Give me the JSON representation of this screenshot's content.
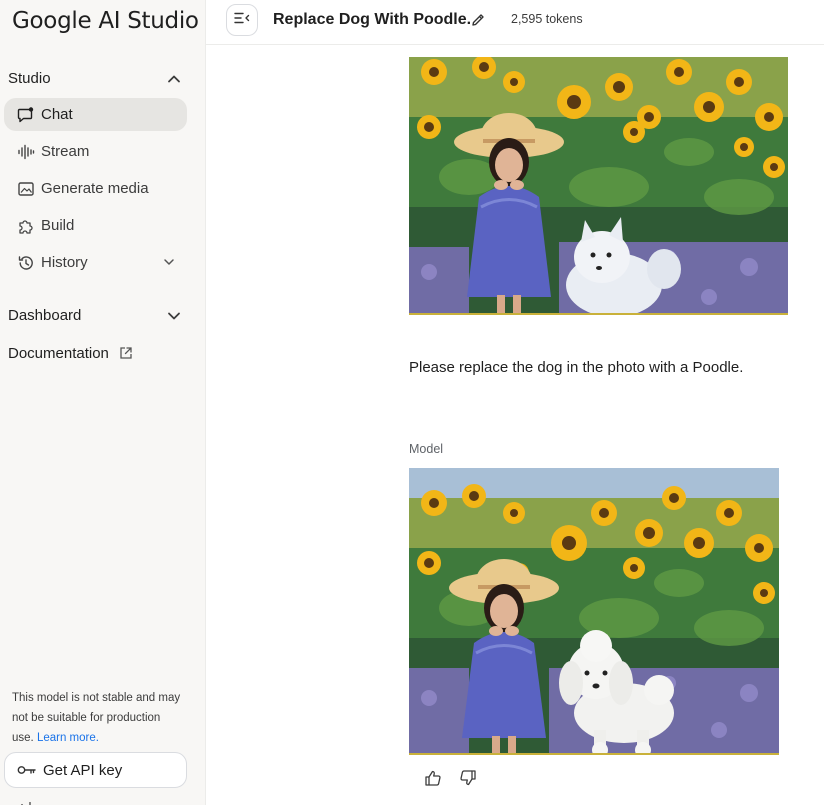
{
  "app": {
    "logo_text": "Google AI Studio"
  },
  "sidebar": {
    "studio_heading": "Studio",
    "items": [
      {
        "label": "Chat",
        "icon": "chat-icon",
        "active": true
      },
      {
        "label": "Stream",
        "icon": "waveform-icon"
      },
      {
        "label": "Generate media",
        "icon": "image-icon"
      },
      {
        "label": "Build",
        "icon": "puzzle-icon"
      },
      {
        "label": "History",
        "icon": "history-icon",
        "expandable": true
      }
    ],
    "dashboard_label": "Dashboard",
    "documentation_label": "Documentation",
    "notice_text": "This model is not stable and may not be suitable for production use.",
    "learn_more": "Learn more.",
    "api_key_label": "Get API key"
  },
  "header": {
    "title": "Replace Dog With Poodle.",
    "tokens": "2,595 tokens"
  },
  "chat": {
    "user_prompt": "Please replace the dog in the photo with a Poodle.",
    "model_label": "Model",
    "user_image_desc": "Painting of girl in straw hat and blue dress among sunflowers with white spitz dog",
    "model_image_desc": "Painting of girl in straw hat and blue dress among sunflowers with white poodle"
  },
  "colors": {
    "sidebar_bg": "#f8f7f5",
    "active_item_bg": "#e6e5e2",
    "link": "#1a73e8",
    "border": "#dadce0"
  }
}
